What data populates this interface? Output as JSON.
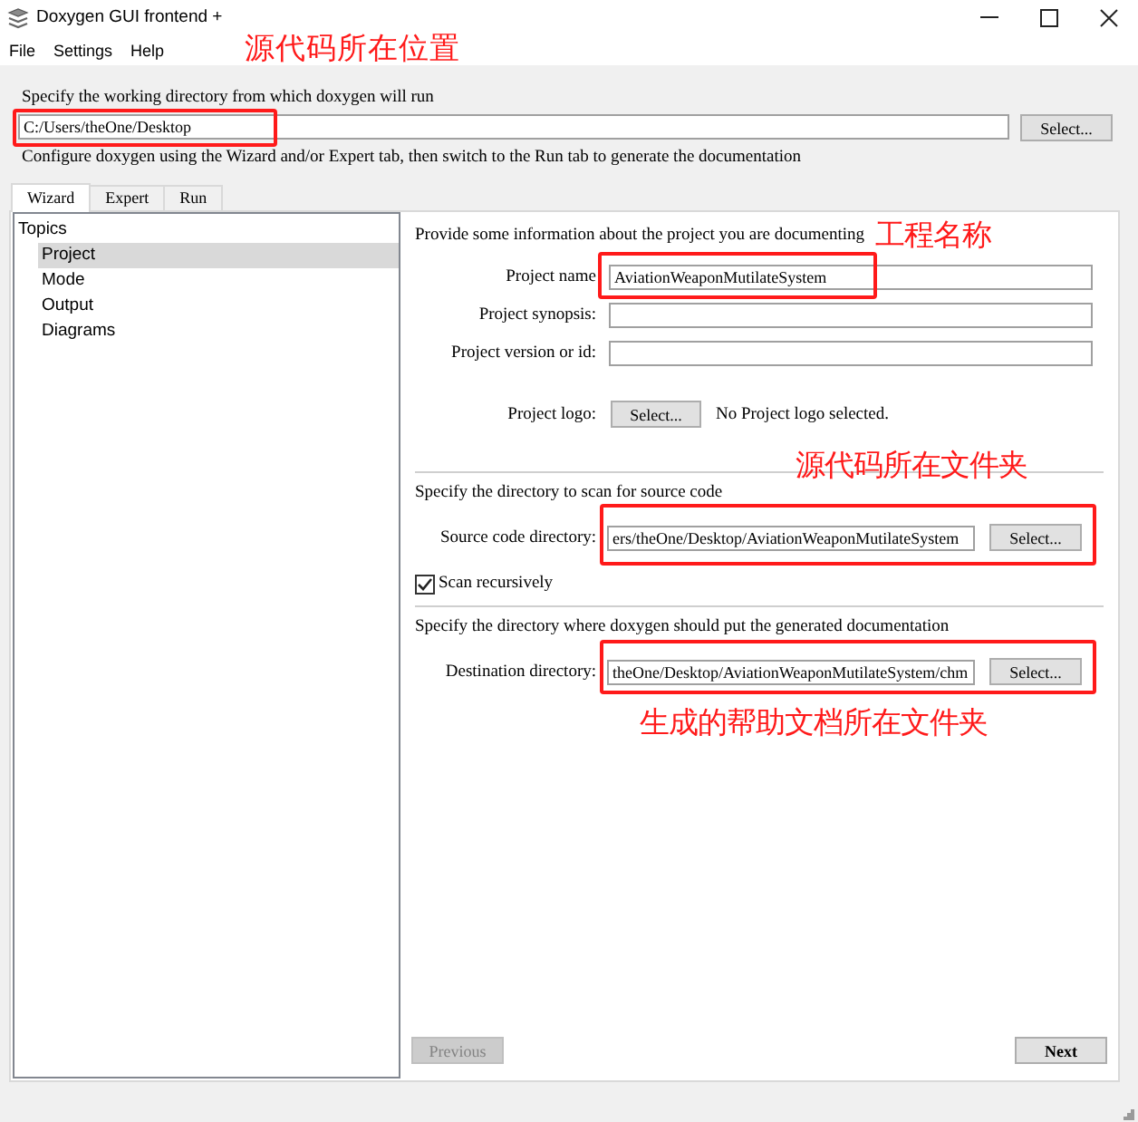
{
  "window": {
    "title": "Doxygen GUI frontend +"
  },
  "menu": [
    "File",
    "Settings",
    "Help"
  ],
  "working_directory": {
    "label": "Specify the working directory from which doxygen will run",
    "value": "C:/Users/theOne/Desktop",
    "button": "Select...",
    "outlined": true,
    "callout": "源代码所在位置"
  },
  "hint": "Configure doxygen using the Wizard and/or Expert tab, then switch to the Run tab to generate the documentation",
  "tabs": [
    {
      "label": "Wizard",
      "selected": true
    },
    {
      "label": "Expert",
      "selected": false
    },
    {
      "label": "Run",
      "selected": false
    }
  ],
  "topics": {
    "label": "Topics",
    "children": [
      {
        "label": "Project",
        "selected": true
      },
      {
        "label": "Mode",
        "selected": false
      },
      {
        "label": "Output",
        "selected": false
      },
      {
        "label": "Diagrams",
        "selected": false
      }
    ]
  },
  "project": {
    "intro": "Provide some information about the project you are documenting",
    "callout": "工程名称",
    "fields": [
      {
        "label": "Project name",
        "value": "AviationWeaponMutilateSystem",
        "outlined": true
      },
      {
        "label": "Project synopsis:",
        "outlined": false
      },
      {
        "label": "Project version or id:",
        "outlined": false
      }
    ],
    "logo": {
      "label": "Project logo:",
      "button": "Select...",
      "status": "No Project logo selected."
    }
  },
  "source": {
    "heading": "Specify the directory to scan for source code",
    "callout": "源代码所在文件夹",
    "label": "Source code directory:",
    "value": "ers/theOne/Desktop/AviationWeaponMutilateSystem",
    "button": "Select...",
    "outlined": true,
    "scan_recursively": {
      "label": "Scan recursively",
      "checked": true
    }
  },
  "destination": {
    "heading": "Specify the directory where doxygen should put the generated documentation",
    "label": "Destination directory:",
    "value": "theOne/Desktop/AviationWeaponMutilateSystem/chm",
    "button": "Select...",
    "outlined": true,
    "callout": "生成的帮助文档所在文件夹"
  },
  "navigation": [
    {
      "label": "Previous",
      "disabled": true,
      "default": false
    },
    {
      "label": "Next",
      "disabled": false,
      "default": true
    }
  ]
}
